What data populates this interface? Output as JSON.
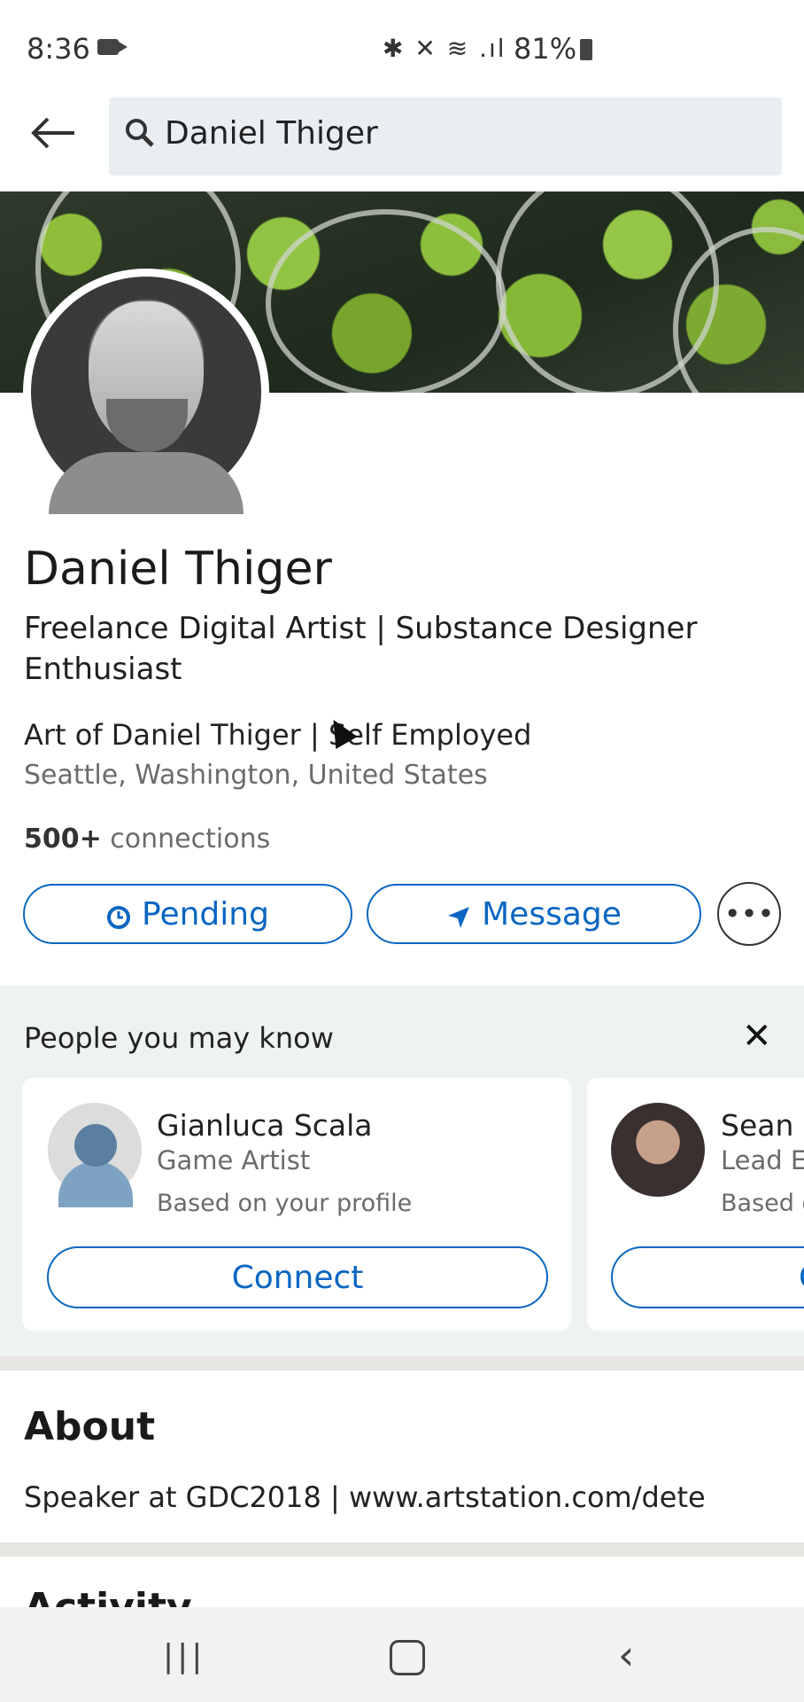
{
  "status_bar": {
    "time": "8:36",
    "icons_text": "✱ ✕ ≋ .ıl",
    "battery": "81%"
  },
  "search": {
    "query": "Daniel Thiger"
  },
  "profile": {
    "name": "Daniel Thiger",
    "headline": "Freelance Digital Artist | Substance Designer Enthusiast",
    "company": "Art of Daniel Thiger | Self Employed",
    "location": "Seattle, Washington, United States",
    "connections_count": "500+",
    "connections_label": " connections"
  },
  "actions": {
    "pending": "Pending",
    "message": "Message",
    "more": "•••"
  },
  "pymk": {
    "title": "People you may know",
    "close": "✕",
    "people": [
      {
        "name": "Gianluca Scala",
        "role": "Game Artist",
        "reason": "Based on your profile",
        "button": "Connect"
      },
      {
        "name": "Sean K",
        "role": "Lead En",
        "reason": "Based o",
        "button": "C"
      }
    ]
  },
  "about": {
    "title": "About",
    "text": "Speaker at GDC2018 | www.artstation.com/dete"
  },
  "activity": {
    "title": "Activity"
  },
  "nav": {
    "recent": "|||",
    "back": "‹"
  },
  "colors": {
    "accent": "#0a66c2",
    "pymk_bg": "#eef3f1"
  }
}
